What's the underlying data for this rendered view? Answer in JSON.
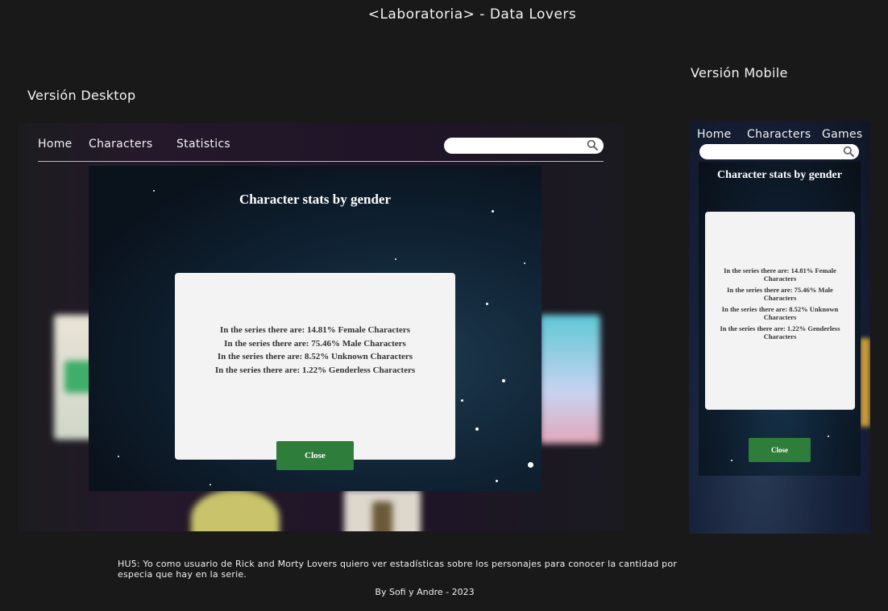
{
  "page": {
    "title": "<Laboratoria> - Data Lovers",
    "desktop_label": "Versión Desktop",
    "mobile_label": "Versión Mobile",
    "user_story": "HU5: Yo como usuario de Rick and Morty Lovers quiero ver estadísticas sobre los personajes para conocer la cantidad por especia que hay en la serie.",
    "credits": "By Sofi y Andre - 2023"
  },
  "desktop": {
    "nav": {
      "home": "Home",
      "characters": "Characters",
      "statistics": "Statistics"
    },
    "search": {
      "placeholder": "",
      "icon": "search-icon"
    },
    "modal": {
      "title": "Character stats by gender",
      "stats": [
        "In the series there are: 14.81% Female Characters",
        "In the series there are: 75.46% Male Characters",
        "In the series there are: 8.52% Unknown Characters",
        "In the series there are: 1.22% Genderless Characters"
      ],
      "close_label": "Close"
    }
  },
  "mobile": {
    "nav": {
      "home": "Home",
      "characters": "Characters",
      "games": "Games"
    },
    "search": {
      "placeholder": "",
      "icon": "search-icon"
    },
    "modal": {
      "title": "Character stats by gender",
      "stats": [
        "In the series there are: 14.81% Female Characters",
        "In the series there are: 75.46% Male Characters",
        "In the series there are: 8.52% Unknown Characters",
        "In the series there are: 1.22% Genderless Characters"
      ],
      "close_label": "Close"
    }
  },
  "colors": {
    "background": "#191919",
    "close_button": "#2e7d3a",
    "stats_box": "#f3f3f3"
  }
}
